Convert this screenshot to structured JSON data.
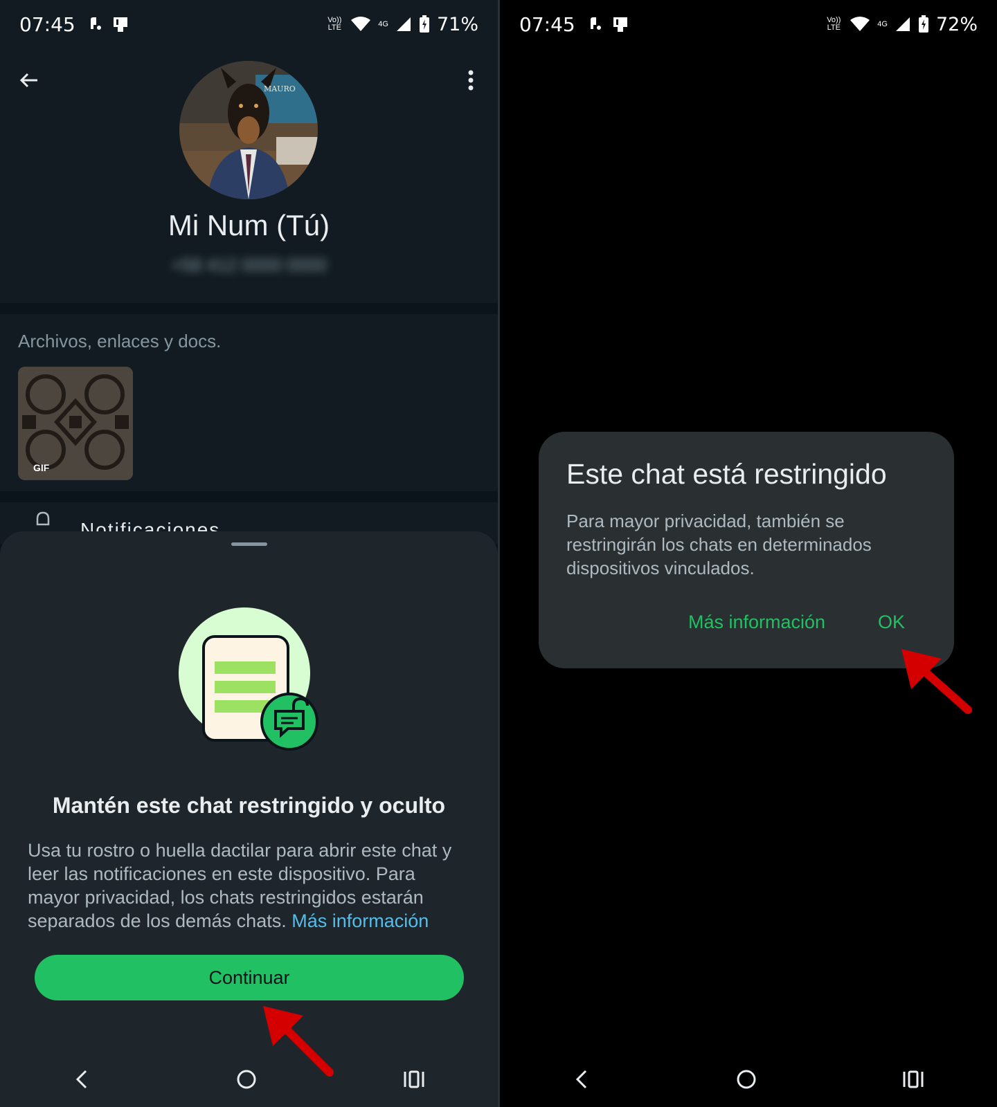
{
  "left_screen": {
    "status_bar": {
      "time": "07:45",
      "volte": "Vo)) LTE",
      "network": "4G",
      "battery": "71%"
    },
    "profile": {
      "name": "Mi Num (Tú)",
      "phone_blurred": "+58 412 0000 0000",
      "avatar_label": "MAURO"
    },
    "media": {
      "section_label": "Archivos, enlaces y docs.",
      "thumb_badge": "GIF"
    },
    "notifications_peek": {
      "label": "Notificaciones"
    },
    "sheet": {
      "title": "Mantén este chat restringido y oculto",
      "body": "Usa tu rostro o huella dactilar para abrir este chat y leer las notificaciones en este dispositivo. Para mayor privacidad, los chats restringidos estarán separados de los demás chats.",
      "link": "Más información",
      "button": "Continuar"
    }
  },
  "right_screen": {
    "status_bar": {
      "time": "07:45",
      "volte": "Vo)) LTE",
      "network": "4G",
      "battery": "72%"
    },
    "dialog": {
      "title": "Este chat está restringido",
      "body": "Para mayor privacidad, también se restringirán los chats en determinados dispositivos vinculados.",
      "more_button": "Más información",
      "ok_button": "OK"
    }
  },
  "icons": {
    "back": "back-arrow-icon",
    "menu": "more-vert-icon",
    "nav_back": "nav-back-icon",
    "nav_home": "nav-home-icon",
    "nav_recents": "nav-recents-icon",
    "lock_chat": "chat-lock-icon"
  },
  "colors": {
    "accent_green": "#21c063",
    "link_blue": "#53bdeb",
    "annotation_red": "#d40000"
  }
}
